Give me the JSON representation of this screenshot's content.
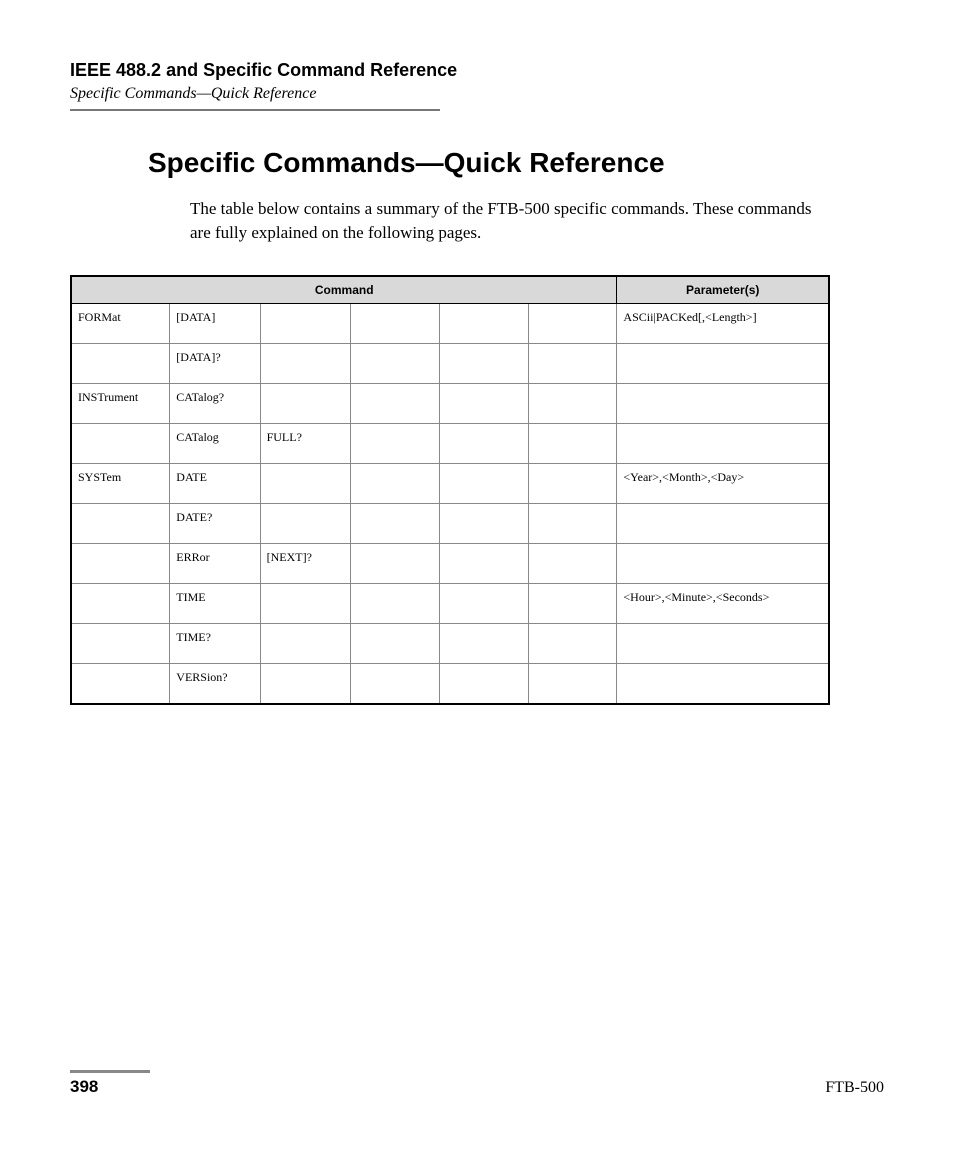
{
  "header": {
    "title": "IEEE 488.2 and Specific Command Reference",
    "subtitle": "Specific Commands—Quick Reference"
  },
  "heading": "Specific Commands—Quick Reference",
  "intro": "The table below contains a summary of the FTB-500 specific commands. These commands are fully explained on the following pages.",
  "table": {
    "head": {
      "command": "Command",
      "params": "Parameter(s)"
    },
    "rows": [
      {
        "c1": "FORMat",
        "c2": "[DATA]",
        "c3": "",
        "c4": "",
        "c5": "",
        "c6": "",
        "params": "ASCii|PACKed[,<Length>]"
      },
      {
        "c1": "",
        "c2": "[DATA]?",
        "c3": "",
        "c4": "",
        "c5": "",
        "c6": "",
        "params": ""
      },
      {
        "c1": "INSTrument",
        "c2": "CATalog?",
        "c3": "",
        "c4": "",
        "c5": "",
        "c6": "",
        "params": ""
      },
      {
        "c1": "",
        "c2": "CATalog",
        "c3": "FULL?",
        "c4": "",
        "c5": "",
        "c6": "",
        "params": ""
      },
      {
        "c1": "SYSTem",
        "c2": "DATE",
        "c3": "",
        "c4": "",
        "c5": "",
        "c6": "",
        "params": "<Year>,<Month>,<Day>"
      },
      {
        "c1": "",
        "c2": "DATE?",
        "c3": "",
        "c4": "",
        "c5": "",
        "c6": "",
        "params": ""
      },
      {
        "c1": "",
        "c2": "ERRor",
        "c3": "[NEXT]?",
        "c4": "",
        "c5": "",
        "c6": "",
        "params": ""
      },
      {
        "c1": "",
        "c2": "TIME",
        "c3": "",
        "c4": "",
        "c5": "",
        "c6": "",
        "params": "<Hour>,<Minute>,<Seconds>"
      },
      {
        "c1": "",
        "c2": "TIME?",
        "c3": "",
        "c4": "",
        "c5": "",
        "c6": "",
        "params": ""
      },
      {
        "c1": "",
        "c2": "VERSion?",
        "c3": "",
        "c4": "",
        "c5": "",
        "c6": "",
        "params": ""
      }
    ]
  },
  "footer": {
    "page": "398",
    "product": "FTB-500"
  }
}
